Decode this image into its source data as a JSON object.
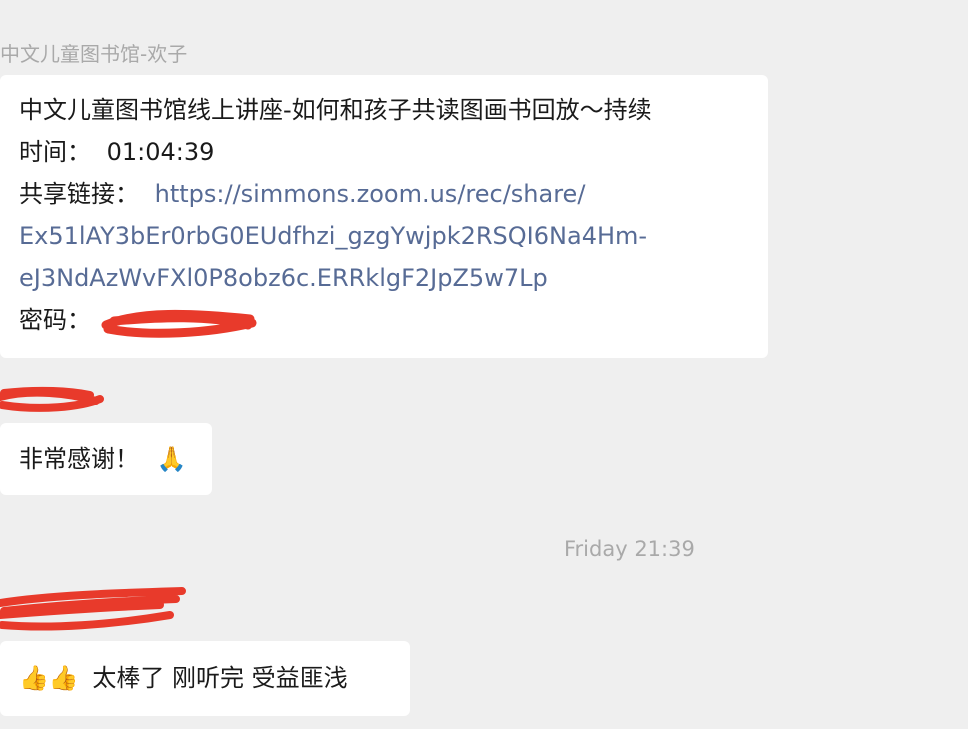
{
  "messages": [
    {
      "sender": "中文儿童图书馆-欢子",
      "title_line": "中文儿童图书馆线上讲座-如何和孩子共读图画书回放～持续",
      "time_label": "时间：",
      "time_value": "01:04:39",
      "link_label": "共享链接：",
      "link_part1": "https://simmons.zoom.us/rec/share/",
      "link_part2": "Ex51lAY3bEr0rbG0EUdfhzi_gzgYwjpk2RSQI6Na4Hm-",
      "link_part3": "eJ3NdAzWvFXl0P8obz6c.ERRklgF2JpZ5w7Lp",
      "password_label": "密码："
    },
    {
      "text": "非常感谢！",
      "emoji": "🙏"
    },
    {
      "emoji": "👍👍",
      "text": "太棒了 刚听完 受益匪浅"
    }
  ],
  "timestamp": "Friday 21:39",
  "colors": {
    "background": "#efefef",
    "bubble": "#ffffff",
    "link": "#576b95",
    "meta_text": "#a9a9a9",
    "redaction": "#e83a2b"
  }
}
